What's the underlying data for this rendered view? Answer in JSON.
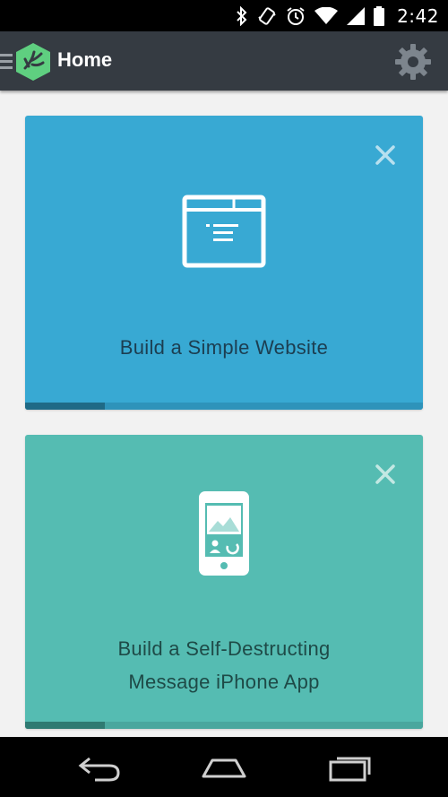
{
  "status_bar": {
    "time": "2:42",
    "icons": [
      "bluetooth-icon",
      "vibrate-icon",
      "alarm-icon",
      "wifi-icon",
      "signal-icon",
      "battery-icon"
    ]
  },
  "action_bar": {
    "title": "Home",
    "icons": [
      "hamburger-icon",
      "app-logo-icon",
      "gear-icon"
    ]
  },
  "cards": [
    {
      "title": "Build a Simple Website",
      "icon": "browser-window-icon",
      "progress": 0.2,
      "background": "#38a9d3"
    },
    {
      "title": "Build a Self-Destructing\nMessage iPhone App",
      "icon": "iphone-icon",
      "progress": 0.2,
      "background": "#55bcb2"
    }
  ],
  "nav_bar": {
    "icons": [
      "back-icon",
      "home-icon",
      "recent-apps-icon"
    ]
  },
  "colors": {
    "action_bar": "#353b42",
    "logo_green": "#5fcf80",
    "content_bg": "#f2f2f2"
  }
}
